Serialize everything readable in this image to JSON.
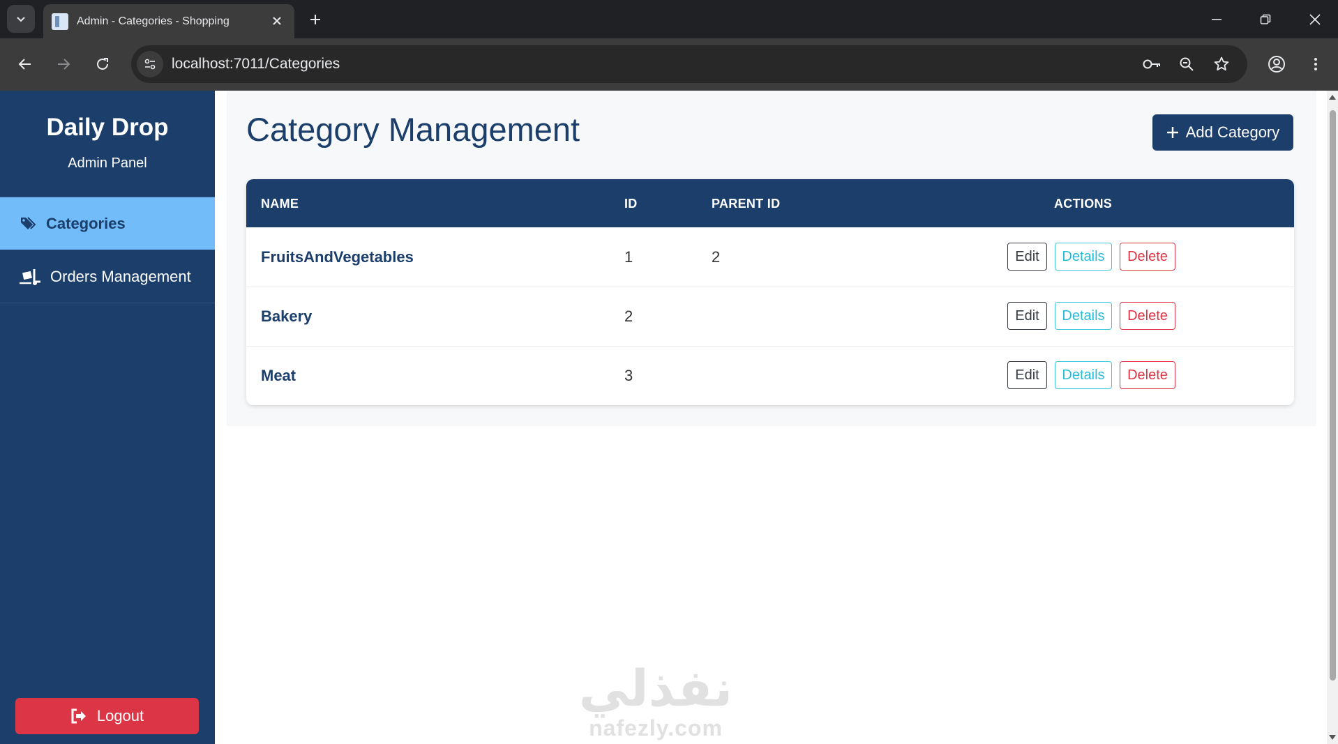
{
  "browser": {
    "tab_title": "Admin - Categories - Shopping",
    "url": "localhost:7011/Categories"
  },
  "sidebar": {
    "brand": "Daily Drop",
    "subtitle": "Admin Panel",
    "items": [
      {
        "label": "Categories",
        "icon": "tags-icon",
        "active": true
      },
      {
        "label": "Orders Management",
        "icon": "truck-loading-icon",
        "active": false
      }
    ],
    "logout_label": "Logout"
  },
  "main": {
    "title": "Category Management",
    "add_button_label": "Add Category",
    "table": {
      "columns": [
        "NAME",
        "ID",
        "PARENT ID",
        "ACTIONS"
      ],
      "rows": [
        {
          "name": "FruitsAndVegetables",
          "id": "1",
          "parent_id": "2"
        },
        {
          "name": "Bakery",
          "id": "2",
          "parent_id": ""
        },
        {
          "name": "Meat",
          "id": "3",
          "parent_id": ""
        }
      ],
      "actions": {
        "edit": "Edit",
        "details": "Details",
        "delete": "Delete"
      }
    }
  },
  "watermark": {
    "arabic": "نفذلي",
    "latin": "nafezly.com"
  },
  "colors": {
    "sidebar_bg": "#1b3e6b",
    "active_item_bg": "#72bcf9",
    "primary": "#1b3e6b",
    "danger": "#dc3545",
    "info": "#2bbbd8"
  }
}
